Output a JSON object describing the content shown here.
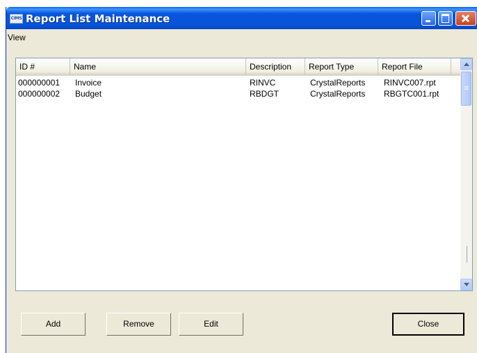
{
  "window": {
    "title": "Report List Maintenance",
    "app_icon_text": "CIMS",
    "controls": {
      "minimize": "minimize-icon",
      "maximize": "maximize-icon",
      "close": "close-icon"
    }
  },
  "menubar": {
    "items": [
      {
        "label": "View"
      }
    ]
  },
  "listview": {
    "columns": [
      {
        "label": "ID #"
      },
      {
        "label": "Name"
      },
      {
        "label": "Description"
      },
      {
        "label": "Report Type"
      },
      {
        "label": "Report File"
      }
    ],
    "rows": [
      {
        "id": "000000001",
        "name": "Invoice",
        "description": "RINVC",
        "report_type": "CrystalReports",
        "report_file": "RINVC007.rpt"
      },
      {
        "id": "000000002",
        "name": "Budget",
        "description": "RBDGT",
        "report_type": "CrystalReports",
        "report_file": "RBGTC001.rpt"
      }
    ]
  },
  "buttons": {
    "add": "Add",
    "remove": "Remove",
    "edit": "Edit",
    "close": "Close"
  },
  "colors": {
    "titlebar": "#0654d8",
    "window_bg": "#ece9d8",
    "list_border": "#7f9db9"
  }
}
